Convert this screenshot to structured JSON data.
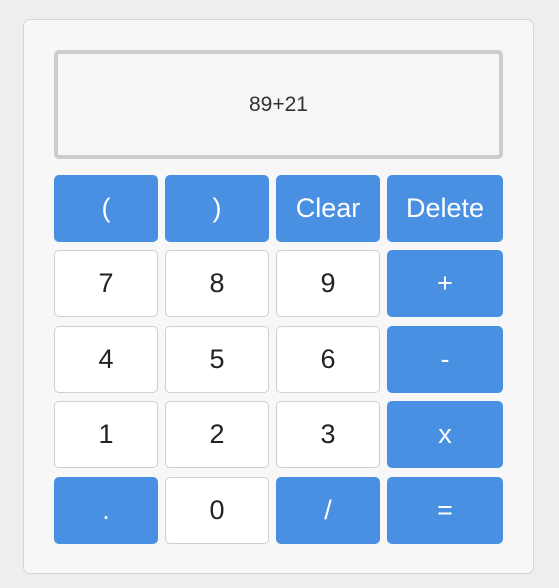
{
  "display": {
    "expression": "89+21"
  },
  "keys": {
    "open_paren": "(",
    "close_paren": ")",
    "clear": "Clear",
    "delete": "Delete",
    "seven": "7",
    "eight": "8",
    "nine": "9",
    "plus": "+",
    "four": "4",
    "five": "5",
    "six": "6",
    "minus": "-",
    "one": "1",
    "two": "2",
    "three": "3",
    "multiply": "x",
    "decimal": ".",
    "zero": "0",
    "divide": "/",
    "equals": "="
  },
  "colors": {
    "accent": "#4a90e2",
    "number_key": "#ffffff",
    "display_border": "#cccccc"
  }
}
